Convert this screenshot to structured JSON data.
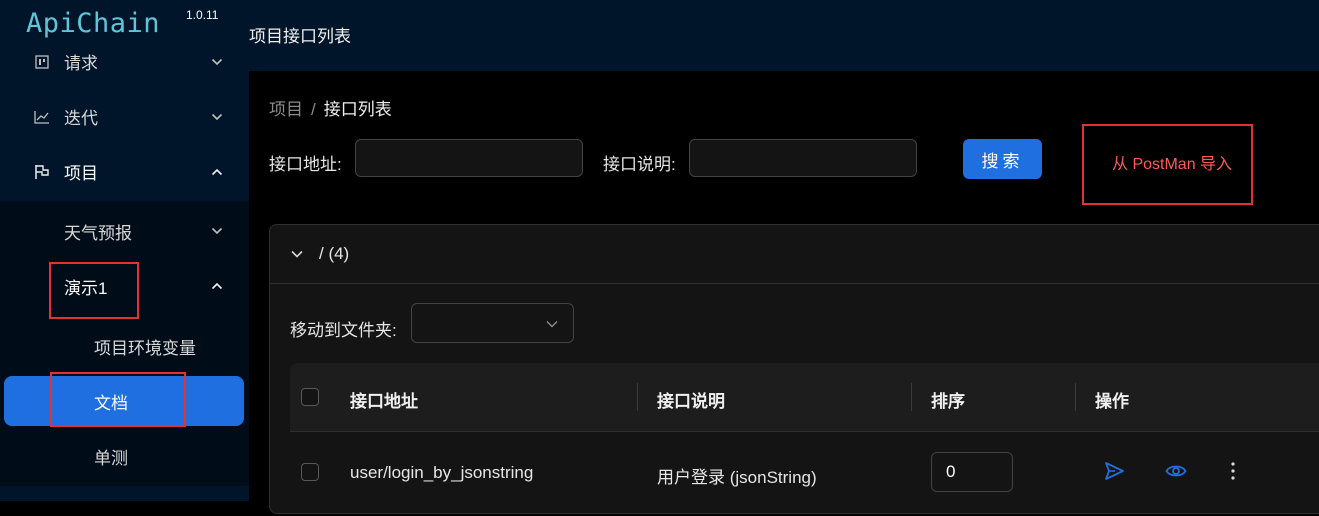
{
  "app": {
    "logo": "ApiChain",
    "version": "1.0.11"
  },
  "sidebar": {
    "menu": [
      {
        "label": "请求",
        "icon": "request-icon",
        "expanded": false
      },
      {
        "label": "迭代",
        "icon": "chart-line-icon",
        "expanded": false
      },
      {
        "label": "项目",
        "icon": "flag-icon",
        "expanded": true
      }
    ],
    "projects": [
      {
        "label": "天气预报",
        "expanded": false
      },
      {
        "label": "演示1",
        "expanded": true
      }
    ],
    "project_items": [
      {
        "label": "项目环境变量"
      },
      {
        "label": "文档",
        "selected": true
      },
      {
        "label": "单测"
      }
    ]
  },
  "header": {
    "title": "项目接口列表"
  },
  "breadcrumb": {
    "parent": "项目",
    "separator": "/",
    "current": "接口列表"
  },
  "search_form": {
    "url_label": "接口地址:",
    "url_value": "",
    "desc_label": "接口说明:",
    "desc_value": "",
    "search_button": "搜索",
    "import_link": "从 PostMan 导入"
  },
  "folder": {
    "title": "/ (4)",
    "move_label": "移动到文件夹:",
    "move_value": ""
  },
  "table": {
    "columns": [
      "接口地址",
      "接口说明",
      "排序",
      "操作"
    ],
    "rows": [
      {
        "url": "user/login_by_jsonstring",
        "desc": "用户登录 (jsonString)",
        "order": "0"
      }
    ]
  },
  "colors": {
    "sidebar_bg": "#001529",
    "accent": "#1f6fe0",
    "highlight_box": "#e23333",
    "import_link": "#ff5a5a"
  }
}
